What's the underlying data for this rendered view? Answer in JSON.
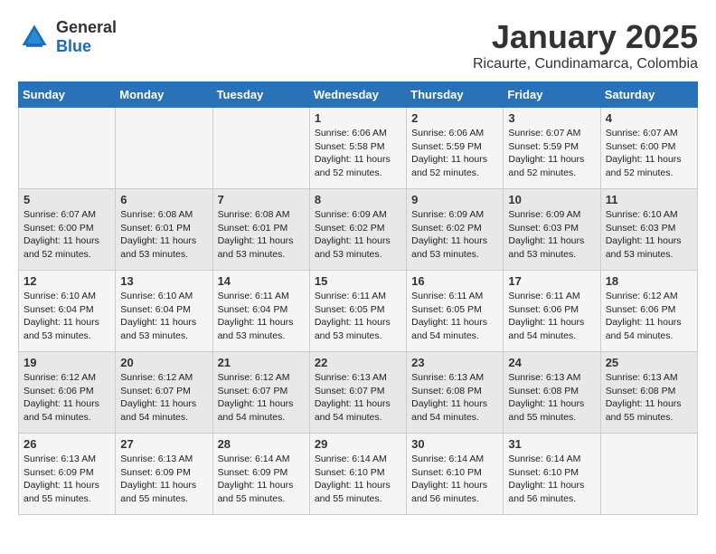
{
  "header": {
    "logo_general": "General",
    "logo_blue": "Blue",
    "month": "January 2025",
    "location": "Ricaurte, Cundinamarca, Colombia"
  },
  "weekdays": [
    "Sunday",
    "Monday",
    "Tuesday",
    "Wednesday",
    "Thursday",
    "Friday",
    "Saturday"
  ],
  "weeks": [
    [
      {
        "day": "",
        "detail": ""
      },
      {
        "day": "",
        "detail": ""
      },
      {
        "day": "",
        "detail": ""
      },
      {
        "day": "1",
        "detail": "Sunrise: 6:06 AM\nSunset: 5:58 PM\nDaylight: 11 hours\nand 52 minutes."
      },
      {
        "day": "2",
        "detail": "Sunrise: 6:06 AM\nSunset: 5:59 PM\nDaylight: 11 hours\nand 52 minutes."
      },
      {
        "day": "3",
        "detail": "Sunrise: 6:07 AM\nSunset: 5:59 PM\nDaylight: 11 hours\nand 52 minutes."
      },
      {
        "day": "4",
        "detail": "Sunrise: 6:07 AM\nSunset: 6:00 PM\nDaylight: 11 hours\nand 52 minutes."
      }
    ],
    [
      {
        "day": "5",
        "detail": "Sunrise: 6:07 AM\nSunset: 6:00 PM\nDaylight: 11 hours\nand 52 minutes."
      },
      {
        "day": "6",
        "detail": "Sunrise: 6:08 AM\nSunset: 6:01 PM\nDaylight: 11 hours\nand 53 minutes."
      },
      {
        "day": "7",
        "detail": "Sunrise: 6:08 AM\nSunset: 6:01 PM\nDaylight: 11 hours\nand 53 minutes."
      },
      {
        "day": "8",
        "detail": "Sunrise: 6:09 AM\nSunset: 6:02 PM\nDaylight: 11 hours\nand 53 minutes."
      },
      {
        "day": "9",
        "detail": "Sunrise: 6:09 AM\nSunset: 6:02 PM\nDaylight: 11 hours\nand 53 minutes."
      },
      {
        "day": "10",
        "detail": "Sunrise: 6:09 AM\nSunset: 6:03 PM\nDaylight: 11 hours\nand 53 minutes."
      },
      {
        "day": "11",
        "detail": "Sunrise: 6:10 AM\nSunset: 6:03 PM\nDaylight: 11 hours\nand 53 minutes."
      }
    ],
    [
      {
        "day": "12",
        "detail": "Sunrise: 6:10 AM\nSunset: 6:04 PM\nDaylight: 11 hours\nand 53 minutes."
      },
      {
        "day": "13",
        "detail": "Sunrise: 6:10 AM\nSunset: 6:04 PM\nDaylight: 11 hours\nand 53 minutes."
      },
      {
        "day": "14",
        "detail": "Sunrise: 6:11 AM\nSunset: 6:04 PM\nDaylight: 11 hours\nand 53 minutes."
      },
      {
        "day": "15",
        "detail": "Sunrise: 6:11 AM\nSunset: 6:05 PM\nDaylight: 11 hours\nand 53 minutes."
      },
      {
        "day": "16",
        "detail": "Sunrise: 6:11 AM\nSunset: 6:05 PM\nDaylight: 11 hours\nand 54 minutes."
      },
      {
        "day": "17",
        "detail": "Sunrise: 6:11 AM\nSunset: 6:06 PM\nDaylight: 11 hours\nand 54 minutes."
      },
      {
        "day": "18",
        "detail": "Sunrise: 6:12 AM\nSunset: 6:06 PM\nDaylight: 11 hours\nand 54 minutes."
      }
    ],
    [
      {
        "day": "19",
        "detail": "Sunrise: 6:12 AM\nSunset: 6:06 PM\nDaylight: 11 hours\nand 54 minutes."
      },
      {
        "day": "20",
        "detail": "Sunrise: 6:12 AM\nSunset: 6:07 PM\nDaylight: 11 hours\nand 54 minutes."
      },
      {
        "day": "21",
        "detail": "Sunrise: 6:12 AM\nSunset: 6:07 PM\nDaylight: 11 hours\nand 54 minutes."
      },
      {
        "day": "22",
        "detail": "Sunrise: 6:13 AM\nSunset: 6:07 PM\nDaylight: 11 hours\nand 54 minutes."
      },
      {
        "day": "23",
        "detail": "Sunrise: 6:13 AM\nSunset: 6:08 PM\nDaylight: 11 hours\nand 54 minutes."
      },
      {
        "day": "24",
        "detail": "Sunrise: 6:13 AM\nSunset: 6:08 PM\nDaylight: 11 hours\nand 55 minutes."
      },
      {
        "day": "25",
        "detail": "Sunrise: 6:13 AM\nSunset: 6:08 PM\nDaylight: 11 hours\nand 55 minutes."
      }
    ],
    [
      {
        "day": "26",
        "detail": "Sunrise: 6:13 AM\nSunset: 6:09 PM\nDaylight: 11 hours\nand 55 minutes."
      },
      {
        "day": "27",
        "detail": "Sunrise: 6:13 AM\nSunset: 6:09 PM\nDaylight: 11 hours\nand 55 minutes."
      },
      {
        "day": "28",
        "detail": "Sunrise: 6:14 AM\nSunset: 6:09 PM\nDaylight: 11 hours\nand 55 minutes."
      },
      {
        "day": "29",
        "detail": "Sunrise: 6:14 AM\nSunset: 6:10 PM\nDaylight: 11 hours\nand 55 minutes."
      },
      {
        "day": "30",
        "detail": "Sunrise: 6:14 AM\nSunset: 6:10 PM\nDaylight: 11 hours\nand 56 minutes."
      },
      {
        "day": "31",
        "detail": "Sunrise: 6:14 AM\nSunset: 6:10 PM\nDaylight: 11 hours\nand 56 minutes."
      },
      {
        "day": "",
        "detail": ""
      }
    ]
  ]
}
